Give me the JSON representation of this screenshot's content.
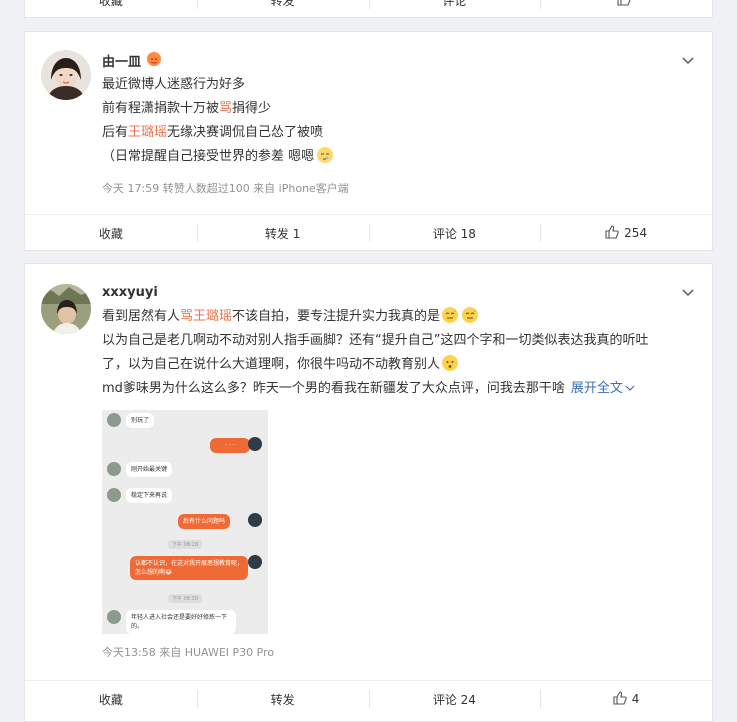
{
  "top_bar": {
    "fav": "收藏",
    "repost": "转发",
    "comment": "评论",
    "like": ""
  },
  "post1": {
    "username": "由一皿",
    "lines": [
      {
        "segments": [
          {
            "t": "最近微博人迷惑行为好多",
            "hl": false
          }
        ]
      },
      {
        "segments": [
          {
            "t": "前有程潇捐款十万被",
            "hl": false
          },
          {
            "t": "骂",
            "hl": true
          },
          {
            "t": "捐得少",
            "hl": false
          }
        ]
      },
      {
        "segments": [
          {
            "t": "后有",
            "hl": false
          },
          {
            "t": "王璐瑶",
            "hl": true
          },
          {
            "t": "无缘决赛调侃自己怂了被喷",
            "hl": false
          }
        ]
      },
      {
        "segments": [
          {
            "t": "（日常提醒自己接受世界的参差 嗯嗯",
            "hl": false
          }
        ]
      }
    ],
    "meta": "今天 17:59 转赞人数超过100  来自 iPhone客户端",
    "actions": {
      "fav": "收藏",
      "repost": "转发 1",
      "comment": "评论 18",
      "like": "254"
    }
  },
  "post2": {
    "username": "xxxyuyi",
    "l1a": "看到居然有人",
    "l1b": "骂王璐瑶",
    "l1c": "不该自拍，要专注提升实力我真的是",
    "l2": "以为自己是老几啊动不动对别人指手画脚？还有“提升自己”这四个字和一切类似表达我真的听吐",
    "l3": "了，以为自己在说什么大道理啊，你很牛吗动不动教育别人",
    "l4": "md爹味男为什么这么多？昨天一个男的看我在新疆发了大众点评，问我去那干啥",
    "more": "展开全文",
    "meta": "今天13:58  来自 HUAWEI P30 Pro",
    "actions": {
      "fav": "收藏",
      "repost": "转发",
      "comment": "评论 24",
      "like": "4"
    },
    "chat": {
      "m1": "别玩了",
      "m2": "· · ·",
      "m3": "刚开始最关键",
      "m4": "稳定下来再说",
      "m5": "后有什么问题吗",
      "t1": "下午 08:28",
      "m6": "认都不认识，在这对我开展思想教育呢，怎么想的啊😂",
      "t2": "下午 08:30",
      "m7": "年轻人进入社会还是要好好修炼一下的。"
    }
  }
}
